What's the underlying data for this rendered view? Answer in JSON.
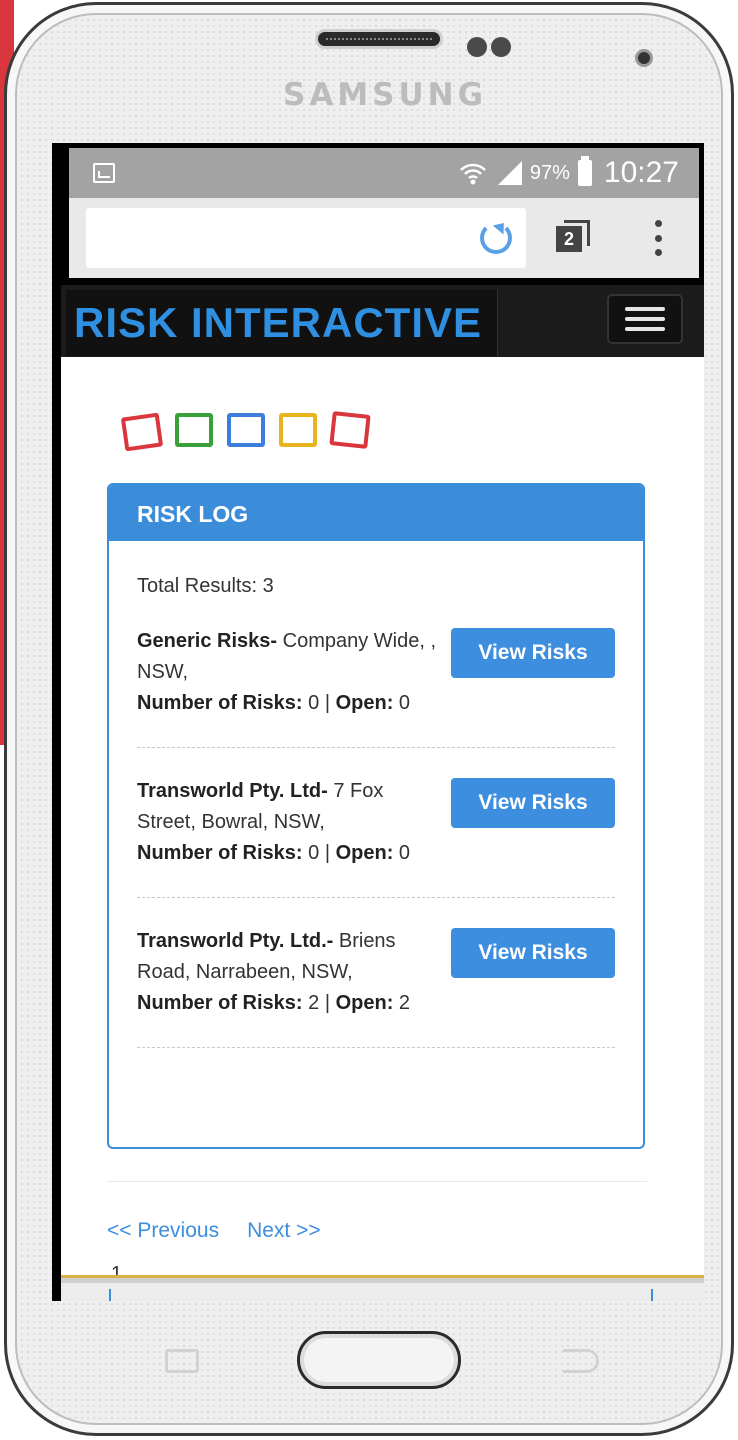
{
  "device": {
    "brand": "SAMSUNG"
  },
  "status_bar": {
    "battery_percent": "97%",
    "time": "10:27"
  },
  "browser": {
    "tab_count": "2"
  },
  "header": {
    "logo": "RISK INTERACTIVE"
  },
  "logo_squares": [
    "#d9363e",
    "#3aa03a",
    "#3c7ed9",
    "#e8b41e",
    "#d9363e"
  ],
  "panel": {
    "title": "RISK LOG",
    "total_label": "Total Results: 3",
    "items": [
      {
        "name": "Generic Risks-",
        "address": " Company Wide, , NSW,",
        "risks_label": "Number of Risks:",
        "risks_value": " 0 | ",
        "open_label": "Open:",
        "open_value": " 0",
        "button": "View Risks"
      },
      {
        "name": "Transworld Pty. Ltd-",
        "address": " 7 Fox Street, Bowral, NSW,",
        "risks_label": "Number of Risks:",
        "risks_value": " 0 | ",
        "open_label": "Open:",
        "open_value": " 0",
        "button": "View Risks"
      },
      {
        "name": "Transworld Pty. Ltd.-",
        "address": " Briens Road, Narrabeen, NSW,",
        "risks_label": "Number of Risks:",
        "risks_value": " 2 | ",
        "open_label": "Open:",
        "open_value": " 2",
        "button": "View Risks"
      }
    ]
  },
  "pagination": {
    "previous": "<< Previous",
    "next": "Next >>",
    "page": "1"
  },
  "colors": {
    "accent": "#3d8ede",
    "logo_blue": "#2f8fe0",
    "navbar": "#1b1b1b"
  }
}
